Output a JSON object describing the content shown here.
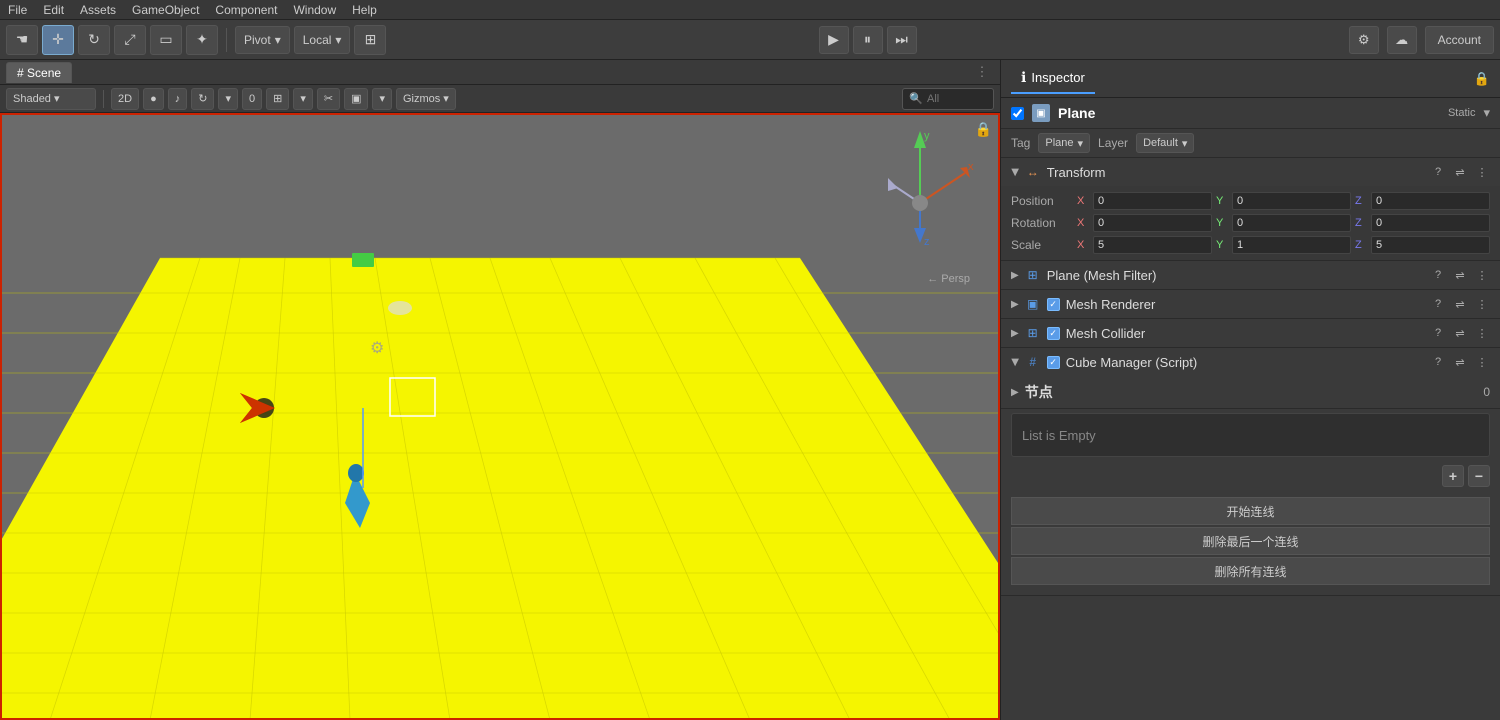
{
  "menubar": {
    "items": [
      "File",
      "Edit",
      "Assets",
      "GameObject",
      "Component",
      "Window",
      "Help"
    ]
  },
  "toolbar": {
    "hand_tool": "✋",
    "move_tool": "⊕",
    "rotate_tool": "↻",
    "scale_tool": "⤢",
    "rect_tool": "▭",
    "transform_tool": "✦",
    "pivot_label": "Pivot",
    "local_label": "Local",
    "snap_icon": "⊞",
    "play_icon": "▶",
    "pause_icon": "⏸",
    "step_icon": "⏭",
    "cloud_icon": "☁",
    "collab_icon": "⚙",
    "account_label": "Account"
  },
  "scene": {
    "tab_label": "Scene",
    "shaded_label": "Shaded",
    "tool_2d": "2D",
    "gizmos_label": "Gizmos",
    "search_placeholder": "All",
    "persp_label": "← Persp",
    "tools": [
      "●",
      "♪",
      "↻",
      "0",
      "⊞",
      "✂",
      "▣"
    ]
  },
  "inspector": {
    "tab_label": "Inspector",
    "tab_icon": "ℹ",
    "object_name": "Plane",
    "static_label": "Static",
    "tag_label": "Tag",
    "tag_value": "Plane",
    "layer_label": "Layer",
    "layer_value": "Default",
    "transform": {
      "name": "Transform",
      "position": {
        "label": "Position",
        "x": "0",
        "y": "0",
        "z": "0"
      },
      "rotation": {
        "label": "Rotation",
        "x": "0",
        "y": "0",
        "z": "0"
      },
      "scale": {
        "label": "Scale",
        "x": "5",
        "y": "1",
        "z": "5"
      }
    },
    "components": [
      {
        "name": "Plane (Mesh Filter)",
        "icon": "⊞",
        "icon_color": "#5a9ce8",
        "has_checkbox": false,
        "id": "mesh-filter"
      },
      {
        "name": "Mesh Renderer",
        "icon": "▣",
        "icon_color": "#5a9ce8",
        "has_checkbox": true,
        "id": "mesh-renderer"
      },
      {
        "name": "Mesh Collider",
        "icon": "⊞",
        "icon_color": "#5a9ce8",
        "has_checkbox": true,
        "id": "mesh-collider"
      },
      {
        "name": "Cube Manager (Script)",
        "icon": "#",
        "icon_color": "#4a7ab5",
        "has_checkbox": true,
        "id": "cube-manager"
      }
    ],
    "nodes_section": {
      "label": "节点",
      "count": "0",
      "list_empty_text": "List is Empty",
      "add_btn": "+",
      "remove_btn": "−"
    },
    "action_buttons": [
      {
        "label": "开始连线",
        "id": "start-connect"
      },
      {
        "label": "删除最后一个连线",
        "id": "delete-last"
      },
      {
        "label": "删除所有连线",
        "id": "delete-all"
      }
    ]
  }
}
